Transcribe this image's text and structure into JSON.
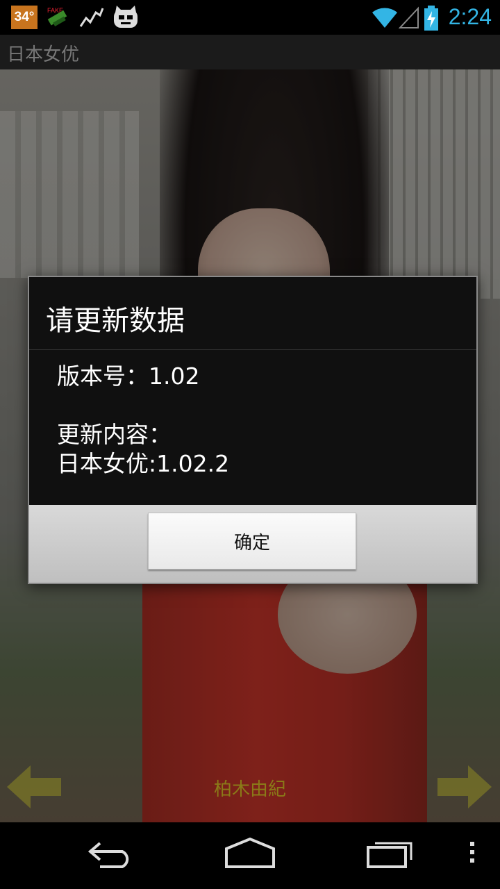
{
  "status_bar": {
    "temperature": "34°",
    "time": "2:24",
    "icons": [
      "fake-location-icon",
      "activity-graph-icon",
      "cyanogen-mascot-icon",
      "wifi-icon",
      "cell-signal-icon",
      "battery-charging-icon"
    ],
    "accent_color": "#33b5e5"
  },
  "action_bar": {
    "title": "日本女优"
  },
  "photo": {
    "caption": "柏木由紀",
    "left_arrow_icon": "arrow-left-icon",
    "right_arrow_icon": "arrow-right-icon"
  },
  "dialog": {
    "title": "请更新数据",
    "version_line": "版本号：1.02",
    "content_label": "更新内容：",
    "content_value": "日本女优:1.02.2",
    "ok_label": "确定"
  },
  "nav_bar": {
    "icons": [
      "back-icon",
      "home-icon",
      "recent-apps-icon",
      "menu-overflow-icon"
    ]
  }
}
